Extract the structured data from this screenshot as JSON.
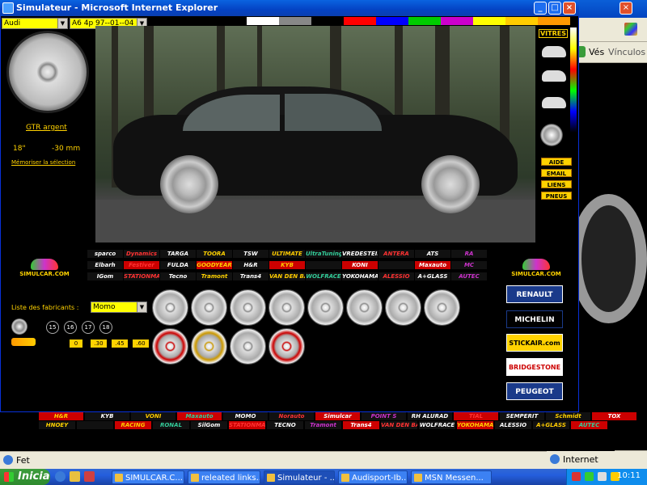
{
  "window": {
    "title": "Simulateur - Microsoft Internet Explorer"
  },
  "bg_window": {
    "address_go": "Vés",
    "links": "Vínculos",
    "status_zone": "Internet"
  },
  "selectors": {
    "make": "Audi",
    "model": "A6 4p 97--01--04"
  },
  "color_swatches": [
    "#ffffff",
    "#888888",
    "#000000",
    "#ff0000",
    "#0000ff",
    "#00cc00",
    "#cc00cc",
    "#ffff00",
    "#ffcc00",
    "#ff9900"
  ],
  "right_panel": {
    "vitres": "VITRES",
    "buttons": [
      "AIDE",
      "EMAIL",
      "LIENS",
      "PNEUS"
    ]
  },
  "left_panel": {
    "rim_name": "GTR argent",
    "size": "18\"",
    "offset": "-30 mm",
    "memorize": "Mémoriser la sélection",
    "site": "SIMULCAR.COM"
  },
  "manufacturers": {
    "label": "Liste des fabricants :",
    "selected": "Momo"
  },
  "sizes": [
    "15",
    "16",
    "17",
    "18"
  ],
  "offsets": [
    "0",
    ".30",
    ".45",
    ".60"
  ],
  "brand_logos_row1": [
    "sparco",
    "Dynamics",
    "TARGA",
    "TOORA",
    "TSW",
    "ULTIMATE",
    "UltraTuning",
    "VREDESTEIN",
    "ANTERA",
    "ATS",
    "RA"
  ],
  "brand_logos_row2": [
    "Elbarh",
    "Festiver",
    "FULDA",
    "GOODYEAR",
    "H&R",
    "KYB",
    "",
    "KONI",
    "",
    "Maxauto",
    "MC"
  ],
  "brand_logos_row3": [
    "IGom",
    "STATIONMARCHE",
    "Tecno",
    "Tramont",
    "Trans4",
    "VAN DEN BAN",
    "WOLFRACE",
    "YOKOHAMA",
    "ALESSIO",
    "A+GLASS",
    "AUTEC"
  ],
  "brand_boxes": [
    "RENAULT",
    "MICHELIN",
    "STICKAIR.com",
    "BRIDGESTONE",
    "PEUGEOT"
  ],
  "bottom_logos_row1": [
    "H&R",
    "KYB",
    "VONI",
    "Maxauto",
    "MOMO",
    "Norauto",
    "Simulcar",
    "POINT S",
    "RH ALURAD",
    "TIAL",
    "SEMPERIT",
    "Schmidt",
    "TOX"
  ],
  "bottom_logos_row2": [
    "HNOEY",
    "",
    "RACING",
    "RONAL",
    "SilGom",
    "STATIONMARCHE",
    "TECNO",
    "Tramont",
    "Trans4",
    "VAN DEN BAN",
    "WOLFRACE",
    "YOKOHAMA",
    "ALESSIO",
    "A+GLASS",
    "AUTEC"
  ],
  "status": {
    "text": "Fet"
  },
  "taskbar": {
    "start": "Inicia",
    "tasks": [
      "SIMULCAR.C...",
      "releated links...",
      "Simulateur - ...",
      "Audisport-Ib...",
      "MSN Messen..."
    ],
    "clock": "10:11"
  }
}
